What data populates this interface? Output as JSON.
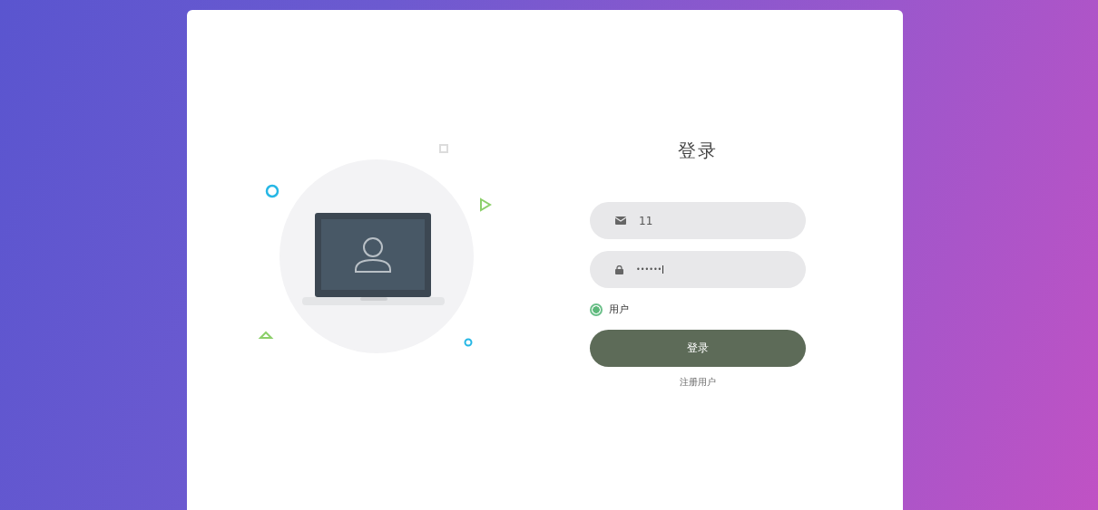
{
  "login": {
    "title": "登录",
    "fields": [
      {
        "kind": "email",
        "value": "11"
      },
      {
        "kind": "password",
        "value": "••••••"
      }
    ],
    "roles": [
      {
        "label": "用户",
        "selected": true
      }
    ],
    "submit": "登录",
    "register_link": "注册用户"
  }
}
